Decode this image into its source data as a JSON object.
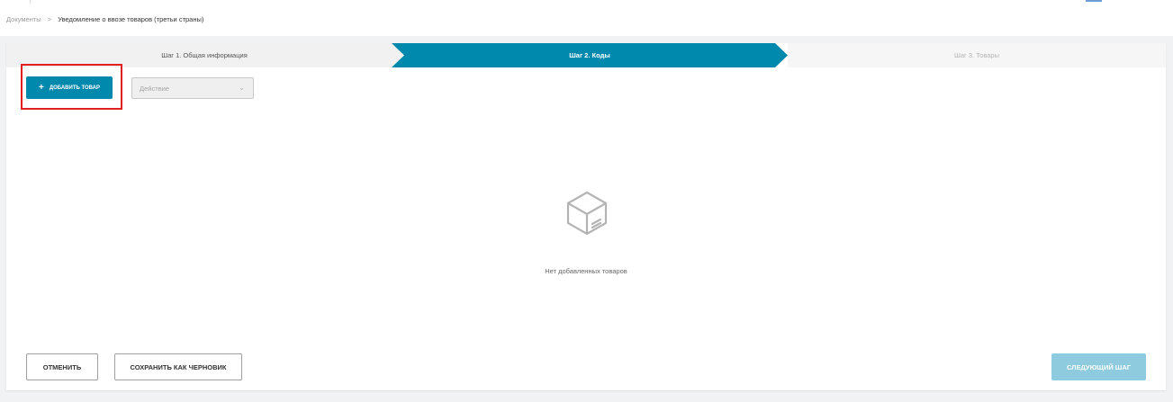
{
  "breadcrumb": {
    "root": "Документы",
    "separator": ">",
    "current": "Уведомление о ввозе товаров (третьи страны)"
  },
  "steps": [
    {
      "label": "Шаг 1. Общая информация",
      "state": "completed"
    },
    {
      "label": "Шаг 2. Коды",
      "state": "active"
    },
    {
      "label": "Шаг 3. Товары",
      "state": "upcoming"
    }
  ],
  "toolbar": {
    "add_plus": "+",
    "add_label": "ДОБАВИТЬ ТОВАР",
    "action_placeholder": "Действие",
    "action_chevron": "⌄"
  },
  "empty_state": {
    "icon": "box-icon",
    "message": "Нет добавленных товаров"
  },
  "footer": {
    "cancel_label": "ОТМЕНИТЬ",
    "draft_label": "СОХРАНИТЬ КАК ЧЕРНОВИК",
    "next_label": "СЛЕДУЮЩИЙ ШАГ",
    "next_disabled": true
  },
  "colors": {
    "accent": "#0088ad",
    "accent_disabled": "#8ecbdf",
    "highlight": "#e02020"
  }
}
